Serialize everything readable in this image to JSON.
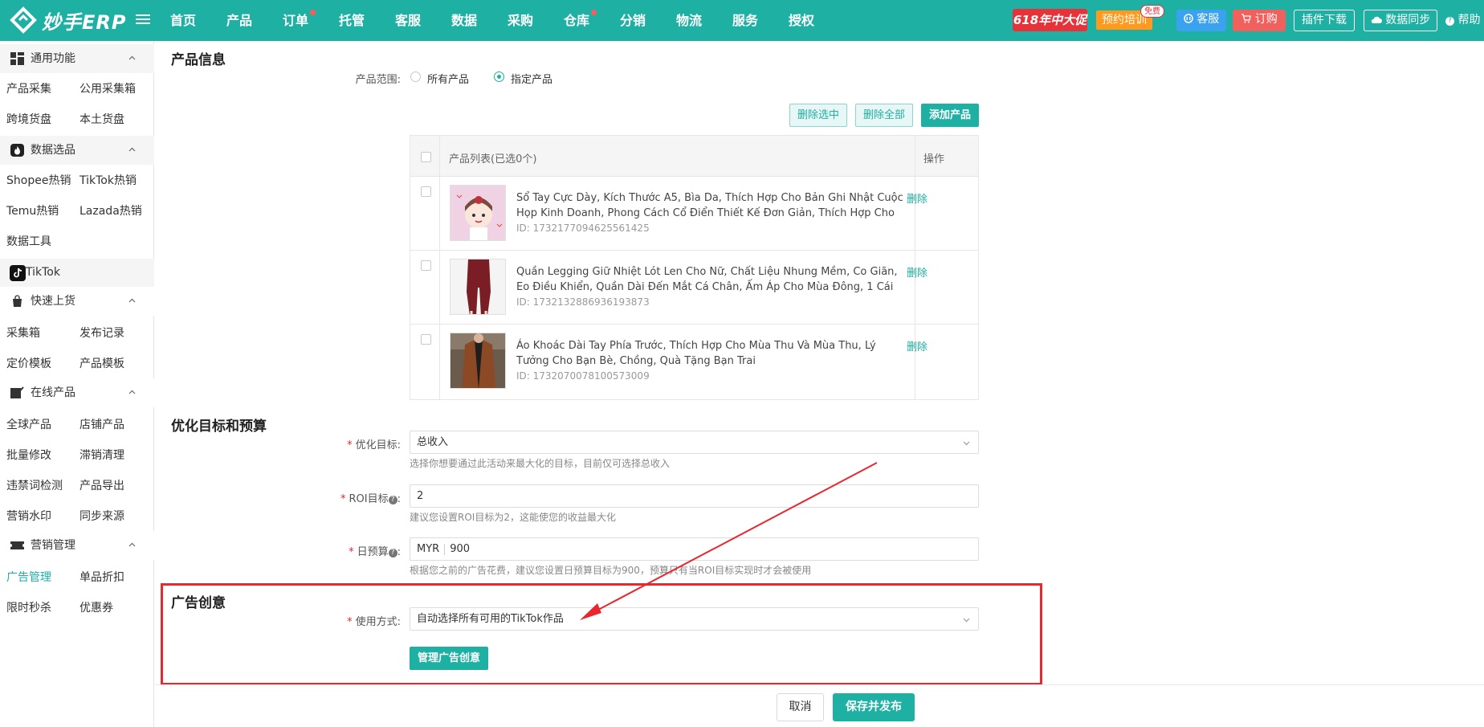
{
  "topbar": {
    "logo_text": "妙手ERP",
    "nav": [
      {
        "label": "首页",
        "dot": false
      },
      {
        "label": "产品",
        "dot": false
      },
      {
        "label": "订单",
        "dot": true
      },
      {
        "label": "托管",
        "dot": false
      },
      {
        "label": "客服",
        "dot": false
      },
      {
        "label": "数据",
        "dot": false
      },
      {
        "label": "采购",
        "dot": false
      },
      {
        "label": "仓库",
        "dot": true
      },
      {
        "label": "分销",
        "dot": false
      },
      {
        "label": "物流",
        "dot": false
      },
      {
        "label": "服务",
        "dot": false
      },
      {
        "label": "授权",
        "dot": false
      }
    ],
    "promo": "618年中大促",
    "training": "预约培训",
    "free_badge": "免费",
    "kefu": "客服",
    "dinggou": "订购",
    "plugin": "插件下载",
    "sync": "数据同步",
    "help": "帮助"
  },
  "sidebar": {
    "sections": [
      {
        "title": "通用功能",
        "icon": "grid-icon"
      },
      {
        "title": "数据选品",
        "icon": "fire-icon"
      },
      {
        "title": "快速上货",
        "icon": "bag-icon"
      },
      {
        "title": "在线产品",
        "icon": "edit-box-icon"
      },
      {
        "title": "营销管理",
        "icon": "ticket-icon"
      }
    ],
    "items": {
      "chanpin_caiji": "产品采集",
      "gongyong_caijixiang": "公用采集箱",
      "kuajing_huopan": "跨境货盘",
      "bentu_huopan": "本土货盘",
      "shopee_rexiao": "Shopee热销",
      "tiktok_rexiao": "TikTok热销",
      "temu_rexiao": "Temu热销",
      "lazada_rexiao": "Lazada热销",
      "shuju_gongju": "数据工具",
      "tiktok": "TikTok",
      "caijixiang": "采集箱",
      "fabu_jilu": "发布记录",
      "dingjia_muban": "定价模板",
      "chanpin_muban": "产品模板",
      "quanqiu_chanpin": "全球产品",
      "dianpu_chanpin": "店铺产品",
      "piliang_xiugai": "批量修改",
      "zhixiao_qingli": "滞销清理",
      "weijinci_jiance": "违禁词检测",
      "chanpin_daochu": "产品导出",
      "yingxiao_shuiyin": "营销水印",
      "tongbu_laiyuan": "同步来源",
      "guanggao_guanli": "广告管理",
      "danpin_zhekou": "单品折扣",
      "xianshi_miaosha": "限时秒杀",
      "youhuiquan": "优惠券"
    }
  },
  "product_info": {
    "heading": "产品信息",
    "scope_label": "产品范围:",
    "option_all": "所有产品",
    "option_specified": "指定产品",
    "btn_delete_selected": "删除选中",
    "btn_delete_all": "删除全部",
    "btn_add": "添加产品",
    "table_header": "产品列表(已选0个)",
    "ops_header": "操作",
    "rows": [
      {
        "name": "Sổ Tay Cực Dày, Kích Thước A5, Bìa Da, Thích Hợp Cho Bản Ghi Nhật Cuộc Họp Kinh Doanh, Phong Cách Cổ Điển Thiết Kế Đơn Giản, Thích Hợp Cho Sinh Viên …",
        "id": "ID: 1732177094625561425",
        "action": "删除"
      },
      {
        "name": "Quần Legging Giữ Nhiệt Lót Len Cho Nữ, Chất Liệu Nhung Mềm, Co Giãn, Eo Điều Khiển, Quần Dài Đến Mắt Cá Chân, Ấm Áp Cho Mùa Đông, 1 Cái",
        "id": "ID: 1732132886936193873",
        "action": "删除"
      },
      {
        "name": "Áo Khoác Dài Tay Phía Trước, Thích Hợp Cho Mùa Thu Và Mùa Thu, Lý Tưởng Cho Bạn Bè, Chồng, Quà Tặng Bạn Trai",
        "id": "ID: 1732070078100573009",
        "action": "删除"
      }
    ]
  },
  "budget": {
    "heading": "优化目标和预算",
    "goal_label": "优化目标:",
    "goal_value": "总收入",
    "goal_hint": "选择你想要通过此活动来最大化的目标，目前仅可选择总收入",
    "roi_label": "ROI目标",
    "roi_value": "2",
    "roi_hint": "建议您设置ROI目标为2，这能使您的收益最大化",
    "daily_label": "日预算",
    "daily_currency": "MYR",
    "daily_value": "900",
    "daily_hint": "根据您之前的广告花费，建议您设置日预算目标为900，预算只有当ROI目标实现时才会被使用",
    "colon": ":",
    "qmark": "?"
  },
  "creative": {
    "heading": "广告创意",
    "mode_label": "使用方式:",
    "mode_value": "自动选择所有可用的TikTok作品",
    "manage_btn": "管理广告创意"
  },
  "footer": {
    "cancel": "取消",
    "save": "保存并发布"
  },
  "colors": {
    "brand": "#1fb0a4",
    "annotation": "#e8272f",
    "promo": "#e8323a"
  }
}
